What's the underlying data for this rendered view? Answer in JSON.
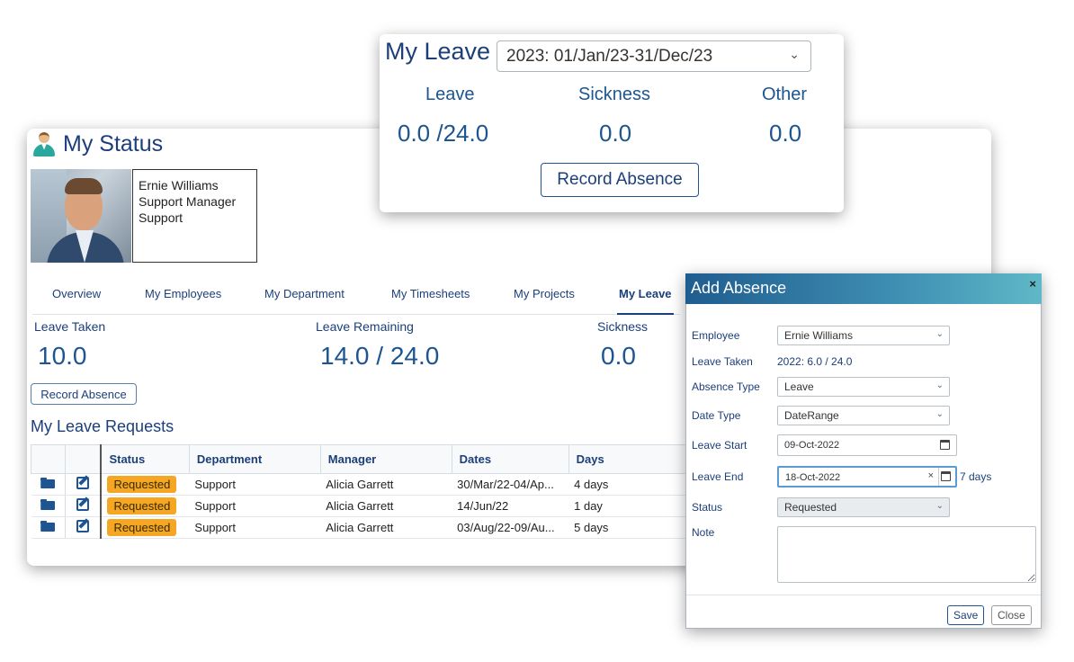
{
  "status_page": {
    "title": "My Status",
    "employee": {
      "name": "Ernie Williams",
      "job_title": "Support Manager",
      "department": "Support"
    },
    "tabs": [
      {
        "label": "Overview"
      },
      {
        "label": "My Employees"
      },
      {
        "label": "My Department"
      },
      {
        "label": "My Timesheets"
      },
      {
        "label": "My Projects"
      },
      {
        "label": "My Leave",
        "active": true
      }
    ],
    "stats": {
      "leave_taken_label": "Leave Taken",
      "leave_taken_value": "10.0",
      "leave_remaining_label": "Leave Remaining",
      "leave_remaining_value": "14.0 / 24.0",
      "sickness_label": "Sickness",
      "sickness_value": "0.0"
    },
    "record_absence_label": "Record Absence",
    "requests_title": "My Leave Requests",
    "table": {
      "headers": [
        "Status",
        "Department",
        "Manager",
        "Dates",
        "Days"
      ],
      "rows": [
        {
          "status": "Requested",
          "department": "Support",
          "manager": "Alicia Garrett",
          "dates": "30/Mar/22-04/Ap...",
          "days": "4 days"
        },
        {
          "status": "Requested",
          "department": "Support",
          "manager": "Alicia Garrett",
          "dates": "14/Jun/22",
          "days": "1 day"
        },
        {
          "status": "Requested",
          "department": "Support",
          "manager": "Alicia Garrett",
          "dates": "03/Aug/22-09/Au...",
          "days": "5 days"
        }
      ]
    }
  },
  "my_leave_widget": {
    "title": "My Leave",
    "year_selected": "2023: 01/Jan/23-31/Dec/23",
    "leave_label": "Leave",
    "leave_value": "0.0 /24.0",
    "sickness_label": "Sickness",
    "sickness_value": "0.0",
    "other_label": "Other",
    "other_value": "0.0",
    "record_absence_label": "Record Absence"
  },
  "add_absence_dialog": {
    "title": "Add Absence",
    "close_glyph": "×",
    "fields": {
      "employee_label": "Employee",
      "employee_value": "Ernie Williams",
      "leave_taken_label": "Leave Taken",
      "leave_taken_value": "2022: 6.0 / 24.0",
      "absence_type_label": "Absence Type",
      "absence_type_value": "Leave",
      "date_type_label": "Date Type",
      "date_type_value": "DateRange",
      "leave_start_label": "Leave Start",
      "leave_start_value": "09-Oct-2022",
      "leave_end_label": "Leave End",
      "leave_end_value": "18-Oct-2022",
      "leave_days": "7 days",
      "status_label": "Status",
      "status_value": "Requested",
      "note_label": "Note",
      "note_value": ""
    },
    "save_label": "Save",
    "close_label": "Close"
  },
  "colors": {
    "brand": "#1c3f7a",
    "accent": "#1c5591",
    "badge_requested": "#f5a623"
  }
}
